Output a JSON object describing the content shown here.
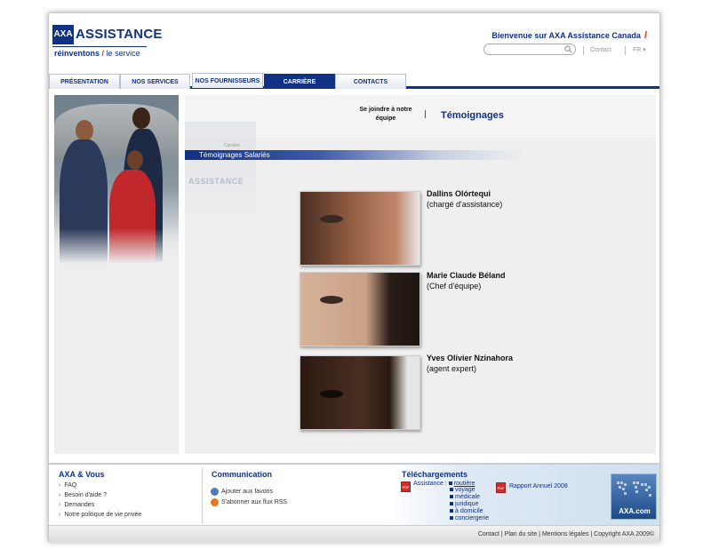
{
  "header": {
    "logo_mark": "AXA",
    "logo_word": "ASSISTANCE",
    "tagline_bold": "réinventons",
    "tagline_slash": "/",
    "tagline_rest": "le service",
    "welcome": "Bienvenue sur AXA Assistance Canada",
    "welcome_slash": "/",
    "search": {
      "value": "",
      "placeholder": ""
    },
    "contact_link": "Contact",
    "lang": "FR ▾"
  },
  "nav": {
    "tabs": [
      {
        "label": "PRÉSENTATION"
      },
      {
        "label": "NOS SERVICES"
      },
      {
        "label": "NOS FOURNISSEURS"
      },
      {
        "label": "CARRIÈRE",
        "active": true
      },
      {
        "label": "CONTACTS"
      }
    ]
  },
  "main": {
    "tab_join": "Se joindre à notre équipe",
    "tab_testimonials": "Témoignages",
    "breadcrumb": "Carrière",
    "section_title": "Témoignages Salariés",
    "watermark": "ASSISTANCE",
    "testimonials": [
      {
        "name": "Dallins Olórtequi",
        "role": "(chargé d'assistance)"
      },
      {
        "name": "Marie Claude Béland",
        "role": "(Chef d'équipe)"
      },
      {
        "name": "Yves Olivier Nzinahora",
        "role": "(agent expert)"
      }
    ]
  },
  "footer": {
    "axa_vous": {
      "title": "AXA & Vous",
      "links": [
        "FAQ",
        "Besoin d'aide ?",
        "Demandes",
        "Notre politique de vie privée"
      ]
    },
    "communication": {
      "title": "Communication",
      "links": [
        "Ajouter aux favoris",
        "S'abonner aux flux RSS"
      ]
    },
    "downloads": {
      "title": "Téléchargements",
      "assistance_label": "Assistance :",
      "assistance_items": [
        "routière",
        "voyage",
        "médicale",
        "juridique",
        "à domicile",
        "conciergerie"
      ],
      "report": "Rapport Annuel 2008",
      "pdf_label": "PDF"
    },
    "axacom": "AXA.com",
    "bottom_links": "Contact | Plan du site | Mentions légales | Copyright AXA 2009©"
  }
}
